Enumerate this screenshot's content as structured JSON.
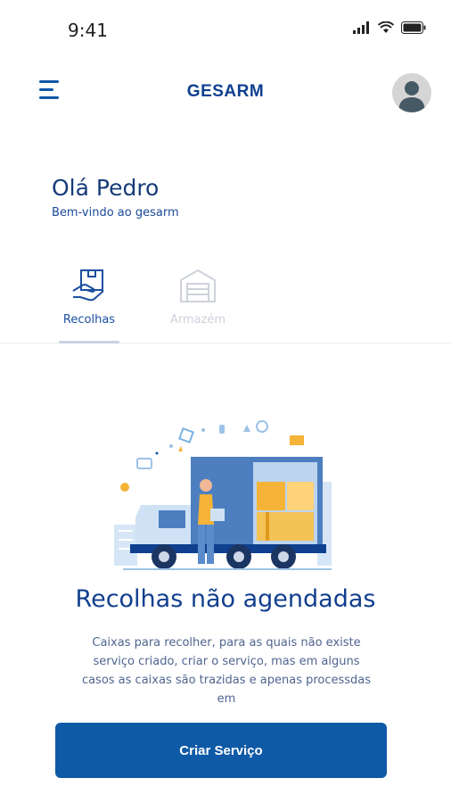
{
  "status_bar": {
    "time": "9:41"
  },
  "header": {
    "title": "GESARM"
  },
  "greeting": {
    "title": "Olá Pedro",
    "subtitle": "Bem-vindo ao gesarm"
  },
  "tabs": [
    {
      "label": "Recolhas",
      "icon": "hand-box-icon",
      "active": true
    },
    {
      "label": "Armazém",
      "icon": "warehouse-icon",
      "active": false
    }
  ],
  "empty_state": {
    "title": "Recolhas não agendadas",
    "description": "Caixas para recolher, para as quais não existe serviço criado, criar o serviço, mas em alguns casos as caixas são trazidas e apenas processdas em"
  },
  "cta": {
    "label": "Criar Serviço"
  },
  "colors": {
    "primary": "#0f5aa7",
    "title": "#123f8e",
    "muted_tab": "#cdd2da"
  }
}
